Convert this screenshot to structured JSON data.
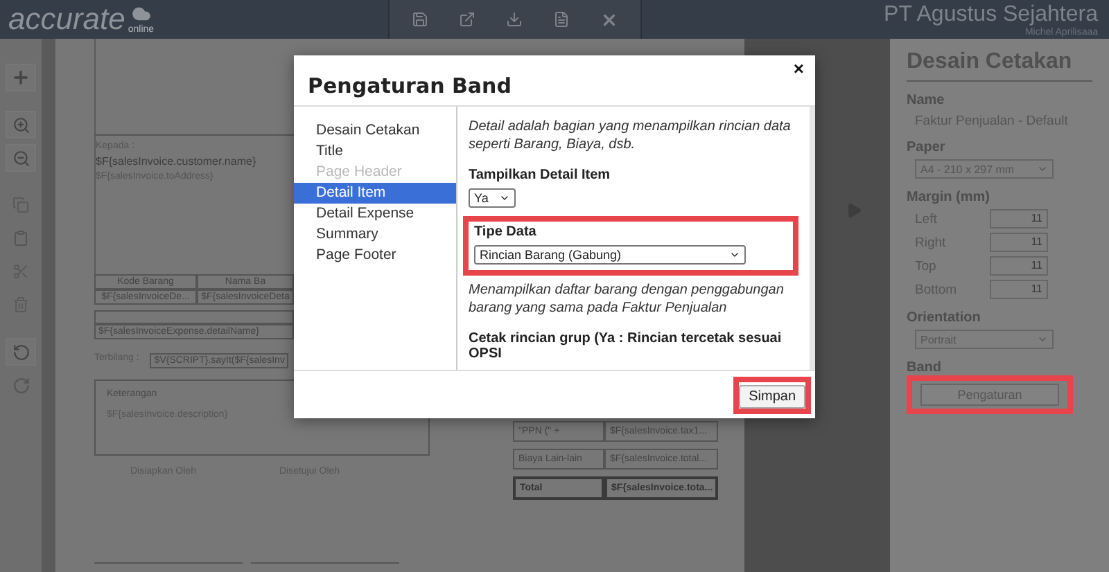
{
  "app_bar": {
    "logo": "accurate",
    "logo_sub": "online",
    "company": "PT Agustus Sejahtera",
    "user": "Michel Aprilisaaa"
  },
  "paper": {
    "to_label": "Kepada :",
    "customer": "$F{salesInvoice.customer.name}",
    "address": "$F{salesInvoice.toAddress}",
    "columns": [
      "Kode Barang",
      "Nama Ba"
    ],
    "row": [
      "$F{salesInvoiceDe...",
      "$F{salesInvoiceDeta"
    ],
    "expense": "$F{salesInvoiceExpense.detailName}",
    "spelled_label": "Terbilang :",
    "spelled_value": "$V{SCRIPT}.sayIt($F{salesInv",
    "notes_label": "Keterangan",
    "notes_value": "$F{salesInvoice.description}",
    "signatures": [
      "Disiapkan Oleh",
      "Disetujui Oleh"
    ],
    "summary": [
      {
        "label": "\"PPN (\" +",
        "value": "$F{salesInvoice.tax1...",
        "bold": false
      },
      {
        "label": "Biaya Lain-lain",
        "value": "$F{salesInvoice.total...",
        "bold": false
      },
      {
        "label": "Total",
        "value": "$F{salesInvoice.tota...",
        "bold": true
      }
    ]
  },
  "modal": {
    "title": "Pengaturan Band",
    "close": "×",
    "nav": [
      {
        "label": "Desain Cetakan",
        "selected": false,
        "disabled": false
      },
      {
        "label": "Title",
        "selected": false,
        "disabled": false
      },
      {
        "label": "Page Header",
        "selected": false,
        "disabled": true
      },
      {
        "label": "Detail Item",
        "selected": true,
        "disabled": false
      },
      {
        "label": "Detail Expense",
        "selected": false,
        "disabled": false
      },
      {
        "label": "Summary",
        "selected": false,
        "disabled": false
      },
      {
        "label": "Page Footer",
        "selected": false,
        "disabled": false
      }
    ],
    "description": "Detail adalah bagian yang menampilkan rincian data seperti Barang, Biaya, dsb.",
    "show_detail": {
      "label": "Tampilkan Detail Item",
      "value": "Ya"
    },
    "data_type": {
      "label": "Tipe Data",
      "value": "Rincian Barang (Gabung)",
      "highlighted": true
    },
    "data_type_note": "Menampilkan daftar barang dengan penggabungan barang yang sama pada Faktur Penjualan",
    "group_label": "Cetak rincian grup (Ya : Rincian tercetak sesuai OPSI",
    "save": {
      "label": "Simpan",
      "highlighted": true
    }
  },
  "side_panel": {
    "title": "Desain Cetakan",
    "name_label": "Name",
    "name_value": "Faktur Penjualan - Default",
    "paper_label": "Paper",
    "paper_value": "A4 - 210 x 297 mm",
    "margin_label": "Margin (mm)",
    "margins": [
      {
        "label": "Left",
        "value": "11"
      },
      {
        "label": "Right",
        "value": "11"
      },
      {
        "label": "Top",
        "value": "11"
      },
      {
        "label": "Bottom",
        "value": "11"
      }
    ],
    "orientation_label": "Orientation",
    "orientation_value": "Portrait",
    "band_label": "Band",
    "band_button": {
      "label": "Pengaturan",
      "highlighted": true
    }
  }
}
